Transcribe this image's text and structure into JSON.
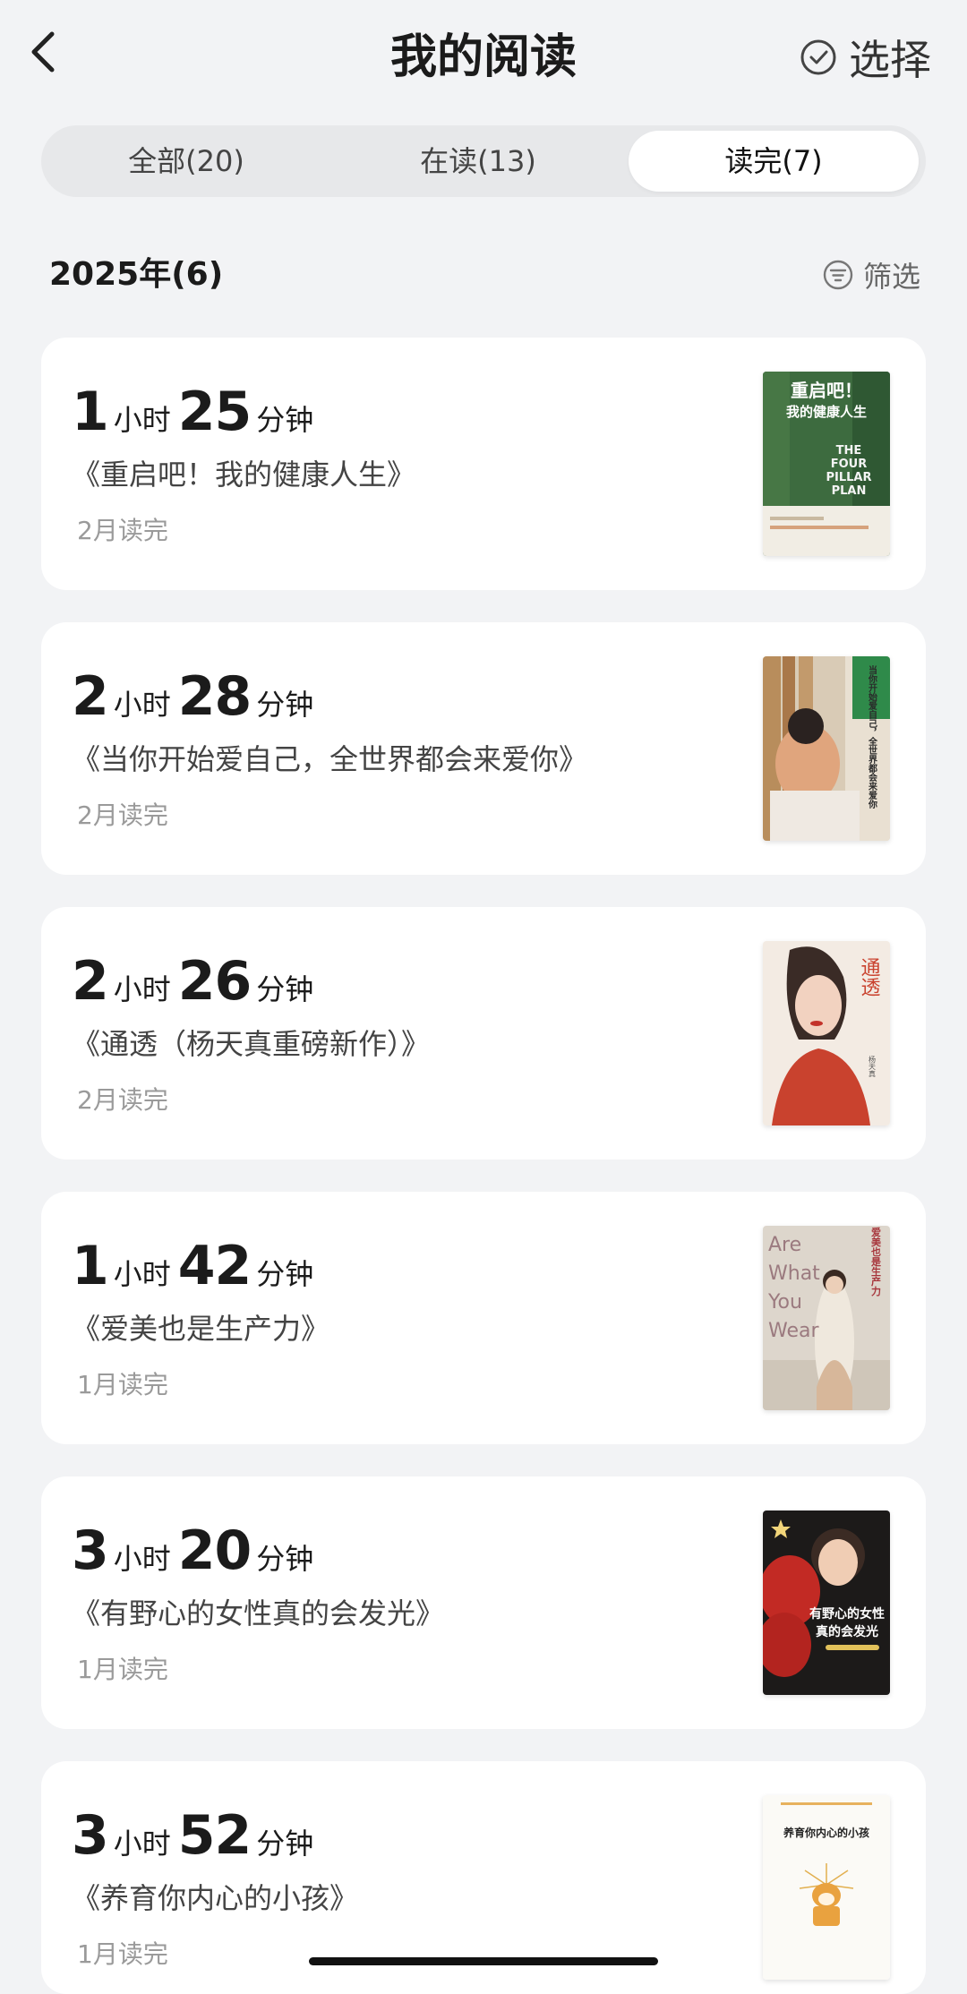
{
  "header": {
    "title": "我的阅读",
    "select_label": "选择"
  },
  "tabs": [
    {
      "label": "全部(20)",
      "active": false
    },
    {
      "label": "在读(13)",
      "active": false
    },
    {
      "label": "读完(7)",
      "active": true
    }
  ],
  "section": {
    "title": "2025年(6)",
    "filter_label": "筛选"
  },
  "books": [
    {
      "hours": "1",
      "minutes": "25",
      "hour_unit": "小时",
      "minute_unit": "分钟",
      "title": "《重启吧！我的健康人生》",
      "finished": "2月读完"
    },
    {
      "hours": "2",
      "minutes": "28",
      "hour_unit": "小时",
      "minute_unit": "分钟",
      "title": "《当你开始爱自己，全世界都会来爱你》",
      "finished": "2月读完"
    },
    {
      "hours": "2",
      "minutes": "26",
      "hour_unit": "小时",
      "minute_unit": "分钟",
      "title": "《通透（杨天真重磅新作）》",
      "finished": "2月读完"
    },
    {
      "hours": "1",
      "minutes": "42",
      "hour_unit": "小时",
      "minute_unit": "分钟",
      "title": "《爱美也是生产力》",
      "finished": "1月读完"
    },
    {
      "hours": "3",
      "minutes": "20",
      "hour_unit": "小时",
      "minute_unit": "分钟",
      "title": "《有野心的女性真的会发光》",
      "finished": "1月读完"
    },
    {
      "hours": "3",
      "minutes": "52",
      "hour_unit": "小时",
      "minute_unit": "分钟",
      "title": "《养育你内心的小孩》",
      "finished": "1月读完"
    }
  ],
  "covers": {
    "book1": {
      "line1": "重启吧！",
      "line2": "我的健康人生",
      "line3": "THE",
      "line4": "FOUR",
      "line5": "PILLAR",
      "line6": "PLAN"
    },
    "book2": {
      "text": "当你开始爱自己，全世界都会来爱你"
    },
    "book3": {
      "text": "通透",
      "author": "杨天真"
    },
    "book4": {
      "en1": "Are",
      "en2": "What",
      "en3": "You",
      "en4": "Wear",
      "cn": "爱美也是生产力"
    },
    "book5": {
      "line1": "有野心的女性",
      "line2": "真的会发光"
    },
    "book6": {
      "title": "养育你内心的小孩"
    }
  },
  "colors": {
    "background": "#f2f3f5",
    "card": "#ffffff",
    "tab_track": "#e7e8ea"
  }
}
